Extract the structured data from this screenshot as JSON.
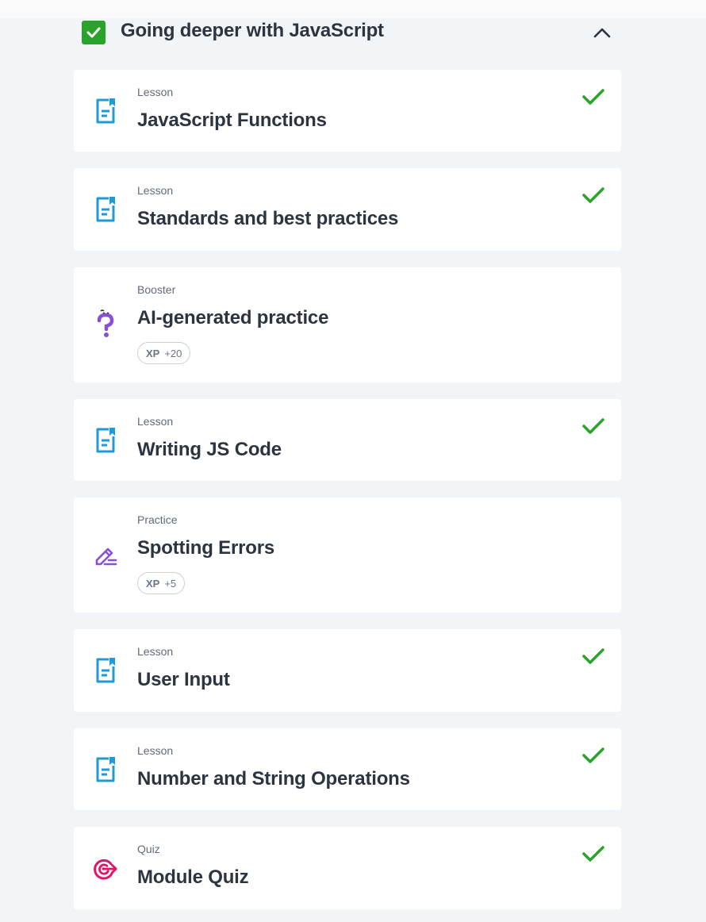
{
  "module": {
    "title": "Going deeper with JavaScript",
    "completed": true,
    "expanded": true
  },
  "colors": {
    "complete_green": "#29a329",
    "lesson_blue": "#1e9bd7",
    "booster_purple": "#8a4fd8",
    "practice_purple": "#8a4fd8",
    "quiz_pink": "#e0166b"
  },
  "items": [
    {
      "kind": "Lesson",
      "title": "JavaScript Functions",
      "icon": "lesson-document-icon",
      "completed": true
    },
    {
      "kind": "Lesson",
      "title": "Standards and best practices",
      "icon": "lesson-document-icon",
      "completed": true
    },
    {
      "kind": "Booster",
      "title": "AI-generated practice",
      "icon": "question-mark-icon",
      "completed": false,
      "xp_label": "XP",
      "xp_value": "+20"
    },
    {
      "kind": "Lesson",
      "title": "Writing JS Code",
      "icon": "lesson-document-icon",
      "completed": true
    },
    {
      "kind": "Practice",
      "title": "Spotting Errors",
      "icon": "pencil-edit-icon",
      "completed": false,
      "xp_label": "XP",
      "xp_value": "+5"
    },
    {
      "kind": "Lesson",
      "title": "User Input",
      "icon": "lesson-document-icon",
      "completed": true
    },
    {
      "kind": "Lesson",
      "title": "Number and String Operations",
      "icon": "lesson-document-icon",
      "completed": true
    },
    {
      "kind": "Quiz",
      "title": "Module Quiz",
      "icon": "target-icon",
      "completed": true
    }
  ]
}
